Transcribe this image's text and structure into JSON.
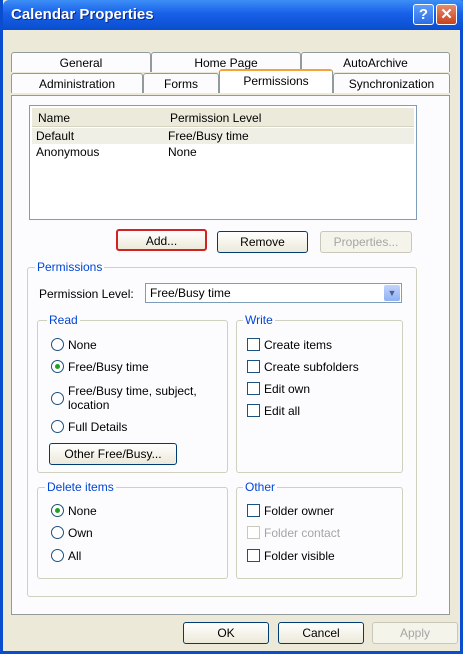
{
  "window": {
    "title": "Calendar Properties",
    "help_icon": "?",
    "close_icon": "✕"
  },
  "tabs_row1": [
    "General",
    "Home Page",
    "AutoArchive"
  ],
  "tabs_row2": [
    "Administration",
    "Forms",
    "Permissions",
    "Synchronization"
  ],
  "active_tab": "Permissions",
  "list": {
    "columns": [
      "Name",
      "Permission Level"
    ],
    "rows": [
      {
        "name": "Default",
        "level": "Free/Busy time",
        "selected": true
      },
      {
        "name": "Anonymous",
        "level": "None",
        "selected": false
      }
    ]
  },
  "list_buttons": {
    "add": "Add...",
    "remove": "Remove",
    "properties": "Properties..."
  },
  "permissions": {
    "legend": "Permissions",
    "level_label": "Permission Level:",
    "level_value": "Free/Busy time"
  },
  "read": {
    "legend": "Read",
    "options": [
      "None",
      "Free/Busy time",
      "Free/Busy time, subject,",
      "location",
      "Full Details"
    ],
    "selected": "Free/Busy time",
    "other_button": "Other Free/Busy..."
  },
  "write": {
    "legend": "Write",
    "options": [
      "Create items",
      "Create subfolders",
      "Edit own",
      "Edit all"
    ]
  },
  "delete_items": {
    "legend": "Delete items",
    "options": [
      "None",
      "Own",
      "All"
    ],
    "selected": "None"
  },
  "other": {
    "legend": "Other",
    "options": [
      "Folder owner",
      "Folder contact",
      "Folder visible"
    ],
    "disabled": [
      "Folder contact"
    ]
  },
  "footer": {
    "ok": "OK",
    "cancel": "Cancel",
    "apply": "Apply"
  },
  "colors": {
    "title_bar": "#0a4ecf",
    "accent_group": "#0046d5",
    "highlight": "#d22222"
  }
}
